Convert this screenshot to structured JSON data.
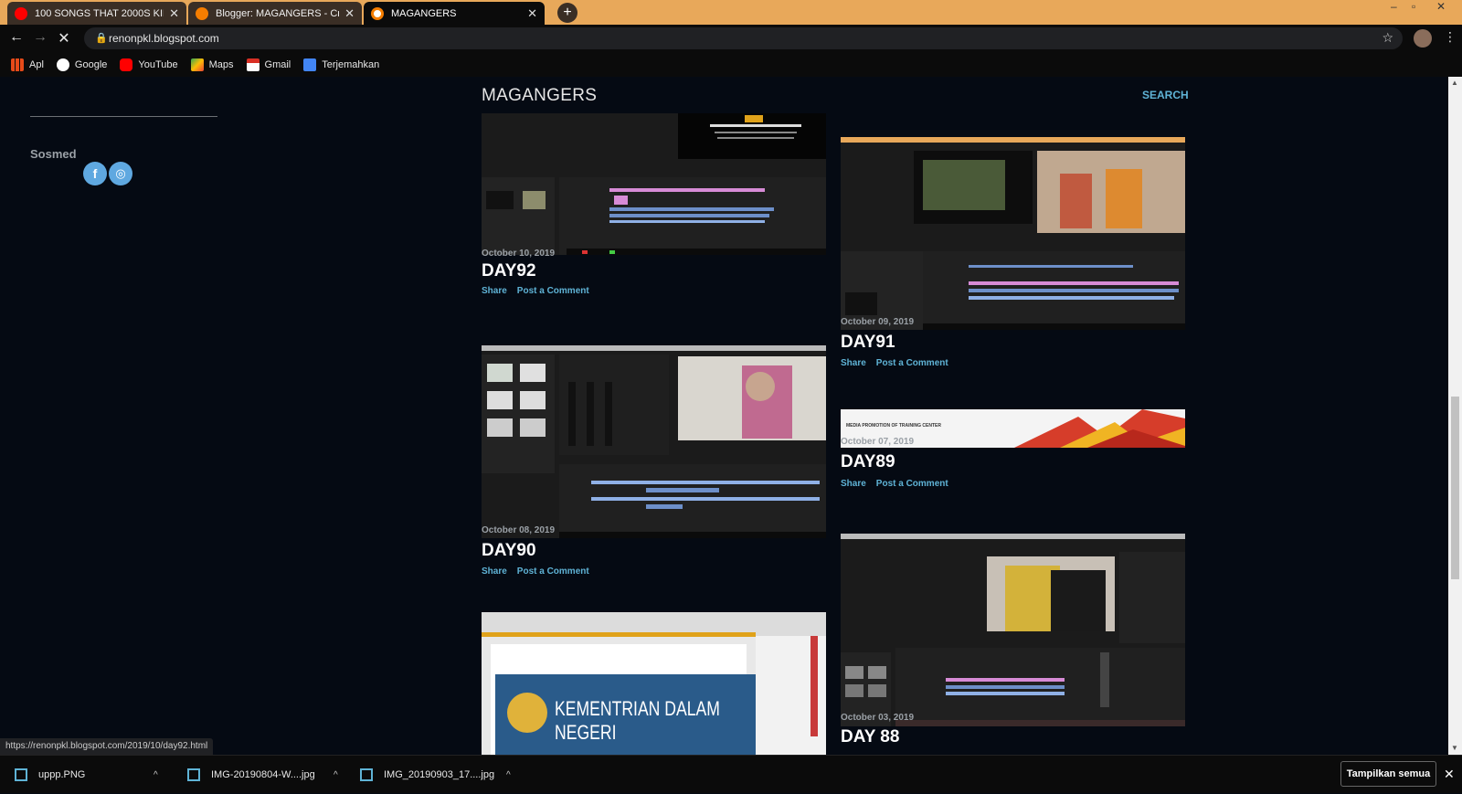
{
  "tabs": [
    {
      "title": "100 SONGS THAT 2000S KID",
      "favicon_color": "#ff0000"
    },
    {
      "title": "Blogger: MAGANGERS - Create p",
      "favicon_color": "#f57d00"
    },
    {
      "title": "MAGANGERS",
      "favicon_color": "#ffffff"
    }
  ],
  "address_bar": {
    "url": "renonpkl.blogspot.com"
  },
  "bookmarks": [
    {
      "label": "Apl",
      "color": "#e64a19"
    },
    {
      "label": "Google",
      "color": "#ffffff"
    },
    {
      "label": "YouTube",
      "color": "#ff0000"
    },
    {
      "label": "Maps",
      "color": "#34a853"
    },
    {
      "label": "Gmail",
      "color": "#d93025"
    },
    {
      "label": "Terjemahkan",
      "color": "#4285f4"
    }
  ],
  "sidebar": {
    "sosmed_label": "Sosmed"
  },
  "blog": {
    "title": "MAGANGERS",
    "search_label": "SEARCH"
  },
  "posts": [
    {
      "date": "October 10, 2019",
      "title": "DAY92",
      "share": "Share",
      "comment": "Post a Comment"
    },
    {
      "date": "October 09, 2019",
      "title": "DAY91",
      "share": "Share",
      "comment": "Post a Comment"
    },
    {
      "date": "October 08, 2019",
      "title": "DAY90",
      "share": "Share",
      "comment": "Post a Comment"
    },
    {
      "date": "October 07, 2019",
      "title": "DAY89",
      "share": "Share",
      "comment": "Post a Comment",
      "banner_text": "MEDIA PROMOTION OF TRAINING CENTER"
    },
    {
      "date": "",
      "title": "",
      "image_text": "KEMENTRIAN DALAM NEGERI"
    },
    {
      "date": "October 03, 2019",
      "title": "DAY 88"
    }
  ],
  "status_url": "https://renonpkl.blogspot.com/2019/10/day92.html",
  "downloads": [
    {
      "name": "uppp.PNG"
    },
    {
      "name": "IMG-20190804-W....jpg"
    },
    {
      "name": "IMG_20190903_17....jpg"
    }
  ],
  "downloads_show_all": "Tampilkan semua"
}
